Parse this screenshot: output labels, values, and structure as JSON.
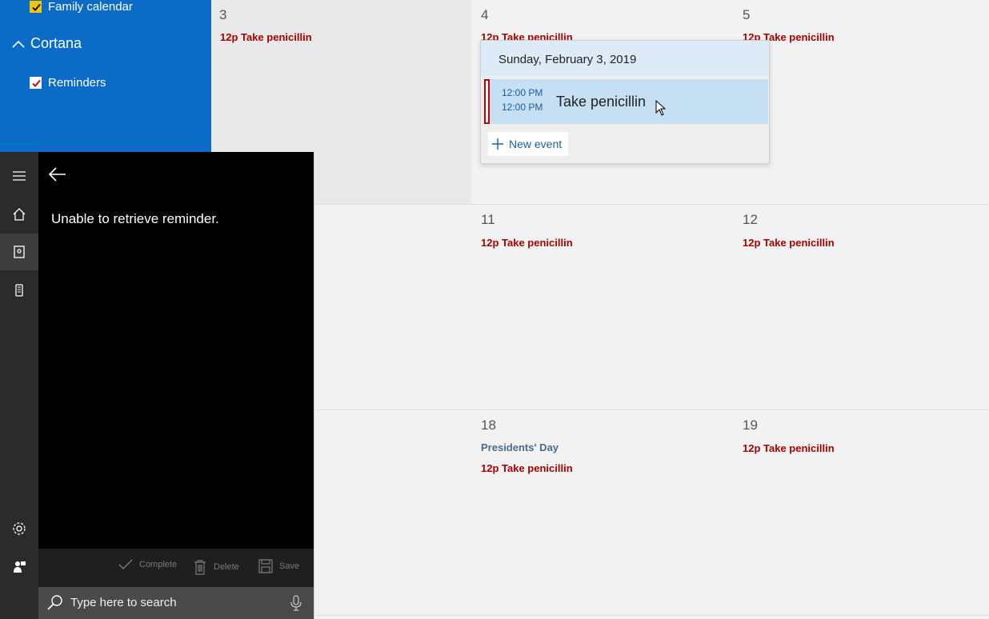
{
  "sidebar": {
    "family_calendar": "Family calendar",
    "cortana_group": "Cortana",
    "reminders": "Reminders"
  },
  "calendar": {
    "days": [
      {
        "num": "3",
        "events": [
          "12p Take penicillin"
        ]
      },
      {
        "num": "4",
        "events": [
          "12p Take penicillin"
        ]
      },
      {
        "num": "5",
        "events": [
          "12p Take penicillin"
        ]
      },
      {
        "num": "11",
        "events": [
          "12p Take penicillin"
        ]
      },
      {
        "num": "12",
        "events": [
          "12p Take penicillin"
        ]
      },
      {
        "num": "18",
        "events": [
          "Presidents' Day",
          "12p Take penicillin"
        ]
      },
      {
        "num": "19",
        "events": [
          "12p Take penicillin"
        ]
      }
    ]
  },
  "popup": {
    "date": "Sunday, February 3, 2019",
    "start_time": "12:00 PM",
    "end_time": "12:00 PM",
    "title": "Take penicillin",
    "new_event": "New event"
  },
  "cortana": {
    "message": "Unable to retrieve reminder.",
    "actions": {
      "complete": "Complete",
      "delete": "Delete",
      "save": "Save"
    },
    "search_placeholder": "Type here to search"
  },
  "colors": {
    "sidebar_blue": "#0b6cc8",
    "event_red": "#a80000",
    "popup_accent": "#c5dff3"
  }
}
